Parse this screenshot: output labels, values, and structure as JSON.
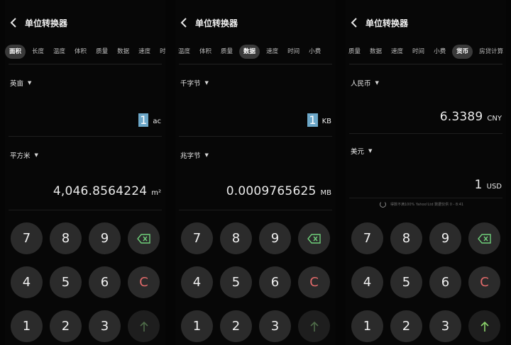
{
  "panels": [
    {
      "title": "单位转换器",
      "tabs": [
        "面积",
        "长度",
        "温度",
        "体积",
        "质量",
        "数据",
        "速度",
        "时"
      ],
      "active_tab": 0,
      "from_unit": "英亩",
      "from_value": "1",
      "from_suffix": "ac",
      "to_unit": "平方米",
      "to_value": "4,046.8564224",
      "to_suffix": "m²"
    },
    {
      "title": "单位转换器",
      "tabs": [
        "温度",
        "体积",
        "质量",
        "数据",
        "速度",
        "时间",
        "小费"
      ],
      "active_tab": 3,
      "from_unit": "千字节",
      "from_value": "1",
      "from_suffix": "KB",
      "to_unit": "兆字节",
      "to_value": "0.0009765625",
      "to_suffix": "MB"
    },
    {
      "title": "单位转换器",
      "tabs": [
        "质量",
        "数据",
        "速度",
        "时间",
        "小费",
        "货币",
        "房贷计算"
      ],
      "active_tab": 5,
      "from_unit": "人民币",
      "from_value": "6.3389",
      "from_suffix": "CNY",
      "to_unit": "美元",
      "to_value": "1",
      "to_suffix": "USD",
      "rate_note": "得数不满100%  Yahoo!Ltd 数据仅供 0 - 8:41"
    }
  ],
  "keys": [
    "7",
    "8",
    "9",
    "4",
    "5",
    "6",
    "C",
    "1",
    "2",
    "3"
  ],
  "colors": {
    "accent_cursor": "#6ca7c8",
    "clear_key": "#e26a6a",
    "up_active": "#8bd36b",
    "key_bg": "#2b2b2b"
  },
  "icons": {
    "back": "chevron-left",
    "dropdown": "triangle-down",
    "backspace": "backspace",
    "up": "arrow-up"
  }
}
